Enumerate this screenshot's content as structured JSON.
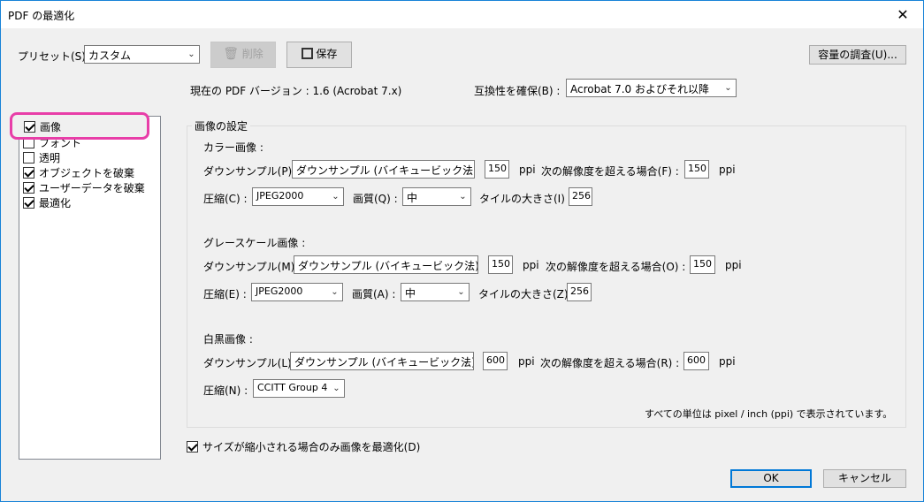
{
  "window": {
    "title": "PDF の最適化",
    "close_glyph": "✕"
  },
  "toolbar": {
    "preset_label": "プリセット(S):",
    "preset_value": "カスタム",
    "delete_label": "削除",
    "save_label": "保存",
    "capacity_label": "容量の調査(U)..."
  },
  "info": {
    "current_version": "現在の PDF バージョン : 1.6 (Acrobat 7.x)",
    "compat_label": "互換性を確保(B) :",
    "compat_value": "Acrobat 7.0 およびそれ以降"
  },
  "sidebar": {
    "items": [
      {
        "label": "画像",
        "checked": true
      },
      {
        "label": "フォント",
        "checked": false
      },
      {
        "label": "透明",
        "checked": false
      },
      {
        "label": "オブジェクトを破棄",
        "checked": true
      },
      {
        "label": "ユーザーデータを破棄",
        "checked": true
      },
      {
        "label": "最適化",
        "checked": true
      }
    ]
  },
  "settings": {
    "group_title": "画像の設定",
    "color": {
      "heading": "カラー画像 :",
      "downsample_label": "ダウンサンプル(P) :",
      "downsample_value": "ダウンサンプル (バイキュービック法)",
      "ppi_value": "150",
      "ppi_unit": "ppi",
      "over_label": "次の解像度を超える場合(F) :",
      "over_value": "150",
      "over_unit": "ppi",
      "compress_label": "圧縮(C) :",
      "compress_value": "JPEG2000",
      "quality_label": "画質(Q) :",
      "quality_value": "中",
      "tile_label": "タイルの大きさ(I) :",
      "tile_value": "256"
    },
    "gray": {
      "heading": "グレースケール画像 :",
      "downsample_label": "ダウンサンプル(M) :",
      "downsample_value": "ダウンサンプル (バイキュービック法)",
      "ppi_value": "150",
      "ppi_unit": "ppi",
      "over_label": "次の解像度を超える場合(O) :",
      "over_value": "150",
      "over_unit": "ppi",
      "compress_label": "圧縮(E) :",
      "compress_value": "JPEG2000",
      "quality_label": "画質(A) :",
      "quality_value": "中",
      "tile_label": "タイルの大きさ(Z) :",
      "tile_value": "256"
    },
    "mono": {
      "heading": "白黒画像 :",
      "downsample_label": "ダウンサンプル(L) :",
      "downsample_value": "ダウンサンプル (バイキュービック法)",
      "ppi_value": "600",
      "ppi_unit": "ppi",
      "over_label": "次の解像度を超える場合(R) :",
      "over_value": "600",
      "over_unit": "ppi",
      "compress_label": "圧縮(N) :",
      "compress_value": "CCITT Group 4"
    },
    "units_note": "すべての単位は pixel / inch (ppi) で表示されています。"
  },
  "footer": {
    "shrink_only_label": "サイズが縮小される場合のみ画像を最適化(D)",
    "shrink_only_checked": true,
    "ok_label": "OK",
    "cancel_label": "キャンセル"
  },
  "colors": {
    "highlight": "#e83ea8",
    "accent": "#0078d7"
  }
}
